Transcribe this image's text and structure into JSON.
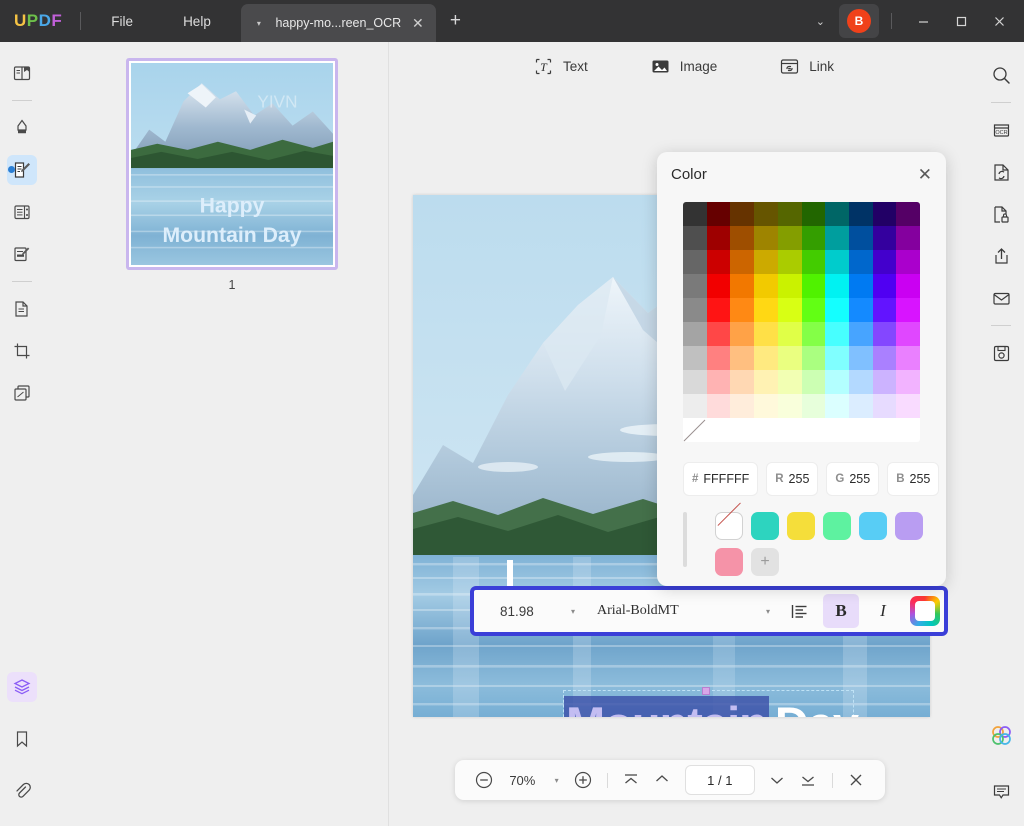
{
  "titlebar": {
    "logo_letters": [
      "U",
      "P",
      "D",
      "F"
    ],
    "menus": [
      {
        "name": "file",
        "label": "File"
      },
      {
        "name": "help",
        "label": "Help"
      }
    ],
    "tab": {
      "title": "happy-mo...reen_OCR",
      "caret": "▾",
      "close": "✕"
    },
    "new_tab": "+",
    "chevron": "⌄",
    "avatar_initial": "B",
    "window_controls": {
      "minimize": "—",
      "maximize": "▫",
      "close": "✕"
    },
    "colors": {
      "bar": "#333334",
      "tab": "#4a4a4c",
      "avatar": "#f0411a"
    }
  },
  "left_rail": {
    "items": [
      {
        "name": "reader-icon",
        "tooltip": "Reader"
      },
      {
        "name": "comment-highlight-icon",
        "tooltip": "Comment"
      },
      {
        "name": "edit-pdf-icon",
        "tooltip": "Edit PDF",
        "active": true
      },
      {
        "name": "organize-pages-icon",
        "tooltip": "Page Tools"
      },
      {
        "name": "fill-sign-icon",
        "tooltip": "Fill & Sign"
      },
      {
        "name": "convert-doc-icon",
        "tooltip": "Convert"
      },
      {
        "name": "crop-icon",
        "tooltip": "Crop"
      },
      {
        "name": "batch-icon",
        "tooltip": "Batch"
      }
    ],
    "bottom_items": [
      {
        "name": "layers-icon",
        "tooltip": "Layers",
        "active": true
      },
      {
        "name": "bookmark-icon",
        "tooltip": "Bookmark"
      },
      {
        "name": "attachment-icon",
        "tooltip": "Attachment"
      }
    ]
  },
  "right_rail": {
    "items": [
      {
        "name": "search-icon",
        "tooltip": "Search"
      },
      {
        "name": "ocr-icon",
        "tooltip": "OCR",
        "label": "OCR"
      },
      {
        "name": "convert-icon",
        "tooltip": "Convert"
      },
      {
        "name": "protect-icon",
        "tooltip": "Protect"
      },
      {
        "name": "share-icon",
        "tooltip": "Share"
      },
      {
        "name": "email-icon",
        "tooltip": "Email"
      },
      {
        "name": "save-icon",
        "tooltip": "Save"
      }
    ],
    "bottom_items": [
      {
        "name": "ai-assistant-icon",
        "tooltip": "AI Assistant"
      },
      {
        "name": "comment-bubble-icon",
        "tooltip": "Comments"
      }
    ]
  },
  "thumbnails": {
    "page_label": "1",
    "image": {
      "watermark": "YIVN",
      "caption_line1": "Happy",
      "caption_line2": "Mountain Day"
    },
    "selected_border": "#c9b6ee"
  },
  "edit_toolbar": {
    "items": [
      {
        "name": "add-text-tool",
        "label": "Text",
        "icon": "text-icon"
      },
      {
        "name": "add-image-tool",
        "label": "Image",
        "icon": "image-icon"
      },
      {
        "name": "add-link-tool",
        "label": "Link",
        "icon": "link-icon"
      }
    ]
  },
  "document": {
    "selected_word": "Mountain",
    "unselected_word": "Day",
    "selection_highlight": "#3b4fa8",
    "handle_color": "#d9a6e8"
  },
  "font_toolbar": {
    "font_size": "81.98",
    "font_size_caret": "▾",
    "font_family": "Arial-BoldMT",
    "font_family_caret": "▾",
    "align_icon": "align-left-icon",
    "bold_label": "B",
    "bold_active": true,
    "italic_label": "I",
    "italic_active": false,
    "color_button": "text-color-icon",
    "border_color": "#3b3fd8"
  },
  "color_panel": {
    "title": "Color",
    "close": "✕",
    "fields": [
      {
        "name": "hex-field",
        "key": "#",
        "value": "FFFFFF"
      },
      {
        "name": "red-field",
        "key": "R",
        "value": "255"
      },
      {
        "name": "green-field",
        "key": "G",
        "value": "255"
      },
      {
        "name": "blue-field",
        "key": "B",
        "value": "255"
      }
    ],
    "current_color": "#FFFFFF",
    "recent_swatches": [
      {
        "name": "no-color-swatch",
        "color": "none"
      },
      {
        "name": "teal-swatch",
        "color": "#2dd4bf"
      },
      {
        "name": "yellow-swatch",
        "color": "#f5de3a"
      },
      {
        "name": "green-swatch",
        "color": "#5ef2a0"
      },
      {
        "name": "sky-swatch",
        "color": "#58cdf5"
      },
      {
        "name": "lavender-swatch",
        "color": "#b99df2"
      },
      {
        "name": "pink-swatch",
        "color": "#f593a8"
      },
      {
        "name": "add-swatch",
        "color": "add"
      }
    ],
    "palette_hues": [
      "#000000",
      "#7f0000",
      "#7f3f00",
      "#bf9f00",
      "#9fbf00",
      "#3fbf00",
      "#00bfbf",
      "#0060bf",
      "#3f00bf",
      "#9f00bf"
    ]
  },
  "bottom_bar": {
    "zoom_out": "zoom-out-icon",
    "zoom_value": "70%",
    "zoom_caret": "▾",
    "zoom_in": "zoom-in-icon",
    "first_page": "first-page-icon",
    "prev_page": "prev-page-icon",
    "page_indicator": "1 / 1",
    "next_page": "next-page-icon",
    "last_page": "last-page-icon",
    "close": "✕"
  }
}
